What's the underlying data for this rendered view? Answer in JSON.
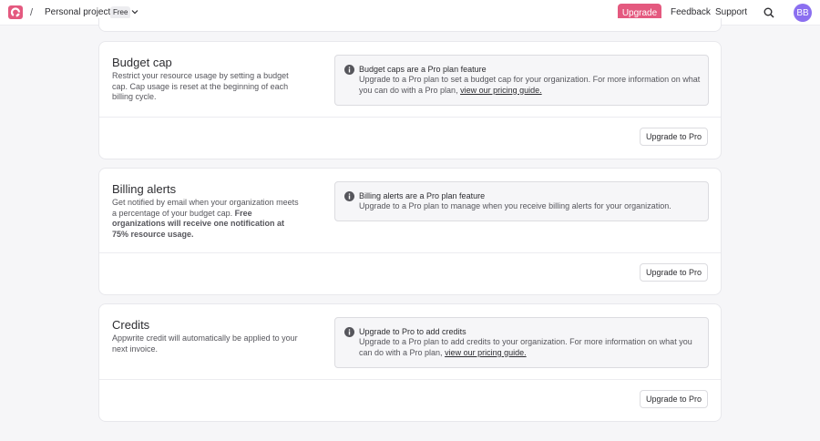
{
  "header": {
    "separator": "/",
    "org_name": "Personal projects",
    "org_badge": "Free",
    "upgrade_label": "Upgrade",
    "feedback_label": "Feedback",
    "support_label": "Support",
    "avatar_initials": "BB",
    "icons": [
      "appwrite-logo-icon",
      "chevron-down-icon",
      "search-icon"
    ]
  },
  "colors": {
    "accent": "#e4597f",
    "avatar": "#8b6ff0"
  },
  "budget_cap": {
    "title": "Budget cap",
    "description": "Restrict your resource usage by setting a budget cap. Cap usage is reset at the beginning of each billing cycle.",
    "alert_title": "Budget caps are a Pro plan feature",
    "alert_body": "Upgrade to a Pro plan to set a budget cap for your organization. For more information on what you can do with a Pro plan, ",
    "alert_link": "view our pricing guide.",
    "button_label": "Upgrade to Pro"
  },
  "billing_alerts": {
    "title": "Billing alerts",
    "description": "Get notified by email when your organization meets a percentage of your budget cap. ",
    "description_bold": "Free organizations will receive one notification at 75% resource usage.",
    "alert_title": "Billing alerts are a Pro plan feature",
    "alert_body": "Upgrade to a Pro plan to manage when you receive billing alerts for your organization.",
    "button_label": "Upgrade to Pro"
  },
  "credits": {
    "title": "Credits",
    "description": "Appwrite credit will automatically be applied to your next invoice.",
    "alert_title": "Upgrade to Pro to add credits",
    "alert_body": "Upgrade to a Pro plan to add credits to your organization. For more information on what you can do with a Pro plan, ",
    "alert_link": "view our pricing guide.",
    "button_label": "Upgrade to Pro"
  }
}
